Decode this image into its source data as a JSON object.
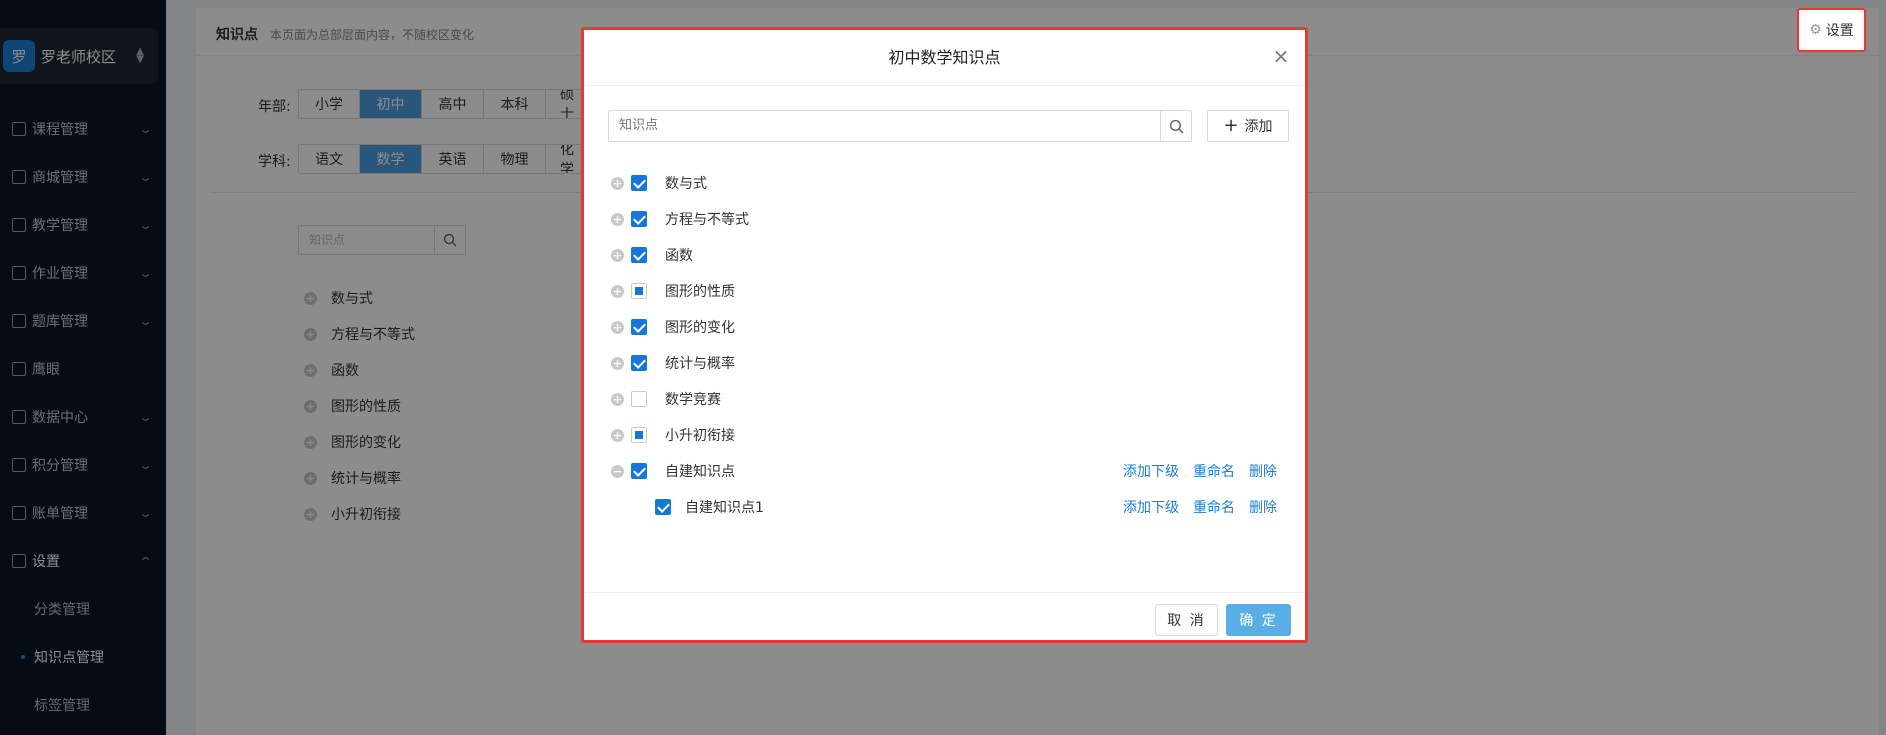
{
  "sidebar": {
    "school_avatar": "罗",
    "school_name": "罗老师校区",
    "items": [
      {
        "label": "课程管理",
        "icon": "book-icon"
      },
      {
        "label": "商城管理",
        "icon": "shop-icon"
      },
      {
        "label": "教学管理",
        "icon": "teaching-icon"
      },
      {
        "label": "作业管理",
        "icon": "homework-icon"
      },
      {
        "label": "题库管理",
        "icon": "question-bank-icon"
      },
      {
        "label": "鹰眼",
        "icon": "eye-icon"
      },
      {
        "label": "数据中心",
        "icon": "chart-icon"
      },
      {
        "label": "积分管理",
        "icon": "star-icon"
      },
      {
        "label": "账单管理",
        "icon": "bill-icon"
      },
      {
        "label": "设置",
        "icon": "grid-icon"
      }
    ],
    "sub_items": [
      {
        "label": "分类管理"
      },
      {
        "label": "知识点管理"
      },
      {
        "label": "标签管理"
      }
    ]
  },
  "page": {
    "title": "知识点",
    "subtitle": "本页面为总部层面内容，不随校区变化",
    "settings_label": "设置",
    "grade_label": "年部:",
    "grades": [
      "小学",
      "初中",
      "高中",
      "本科",
      "硕士"
    ],
    "subject_label": "学科:",
    "subjects": [
      "语文",
      "数学",
      "英语",
      "物理",
      "化学"
    ],
    "search_placeholder": "知识点",
    "tree": [
      "数与式",
      "方程与不等式",
      "函数",
      "图形的性质",
      "图形的变化",
      "统计与概率",
      "小升初衔接"
    ]
  },
  "dialog": {
    "title": "初中数学知识点",
    "search_placeholder": "知识点",
    "add_label": "添加",
    "tree": [
      {
        "label": "数与式",
        "state": "checked",
        "expander": "+"
      },
      {
        "label": "方程与不等式",
        "state": "checked",
        "expander": "+"
      },
      {
        "label": "函数",
        "state": "checked",
        "expander": "+"
      },
      {
        "label": "图形的性质",
        "state": "partial",
        "expander": "+"
      },
      {
        "label": "图形的变化",
        "state": "checked",
        "expander": "+"
      },
      {
        "label": "统计与概率",
        "state": "checked",
        "expander": "+"
      },
      {
        "label": "数学竞赛",
        "state": "unchecked",
        "expander": "+"
      },
      {
        "label": "小升初衔接",
        "state": "partial",
        "expander": "+"
      },
      {
        "label": "自建知识点",
        "state": "checked",
        "expander": "−"
      },
      {
        "label": "自建知识点1",
        "state": "checked",
        "expander": ""
      }
    ],
    "actions": {
      "add_child": "添加下级",
      "rename": "重命名",
      "delete": "删除"
    },
    "cancel_label": "取 消",
    "ok_label": "确 定"
  },
  "colors": {
    "accent": "#1677d9",
    "primary_button": "#5aaee6",
    "highlight_border": "#e53935",
    "sidebar_bg": "#0c1624"
  }
}
